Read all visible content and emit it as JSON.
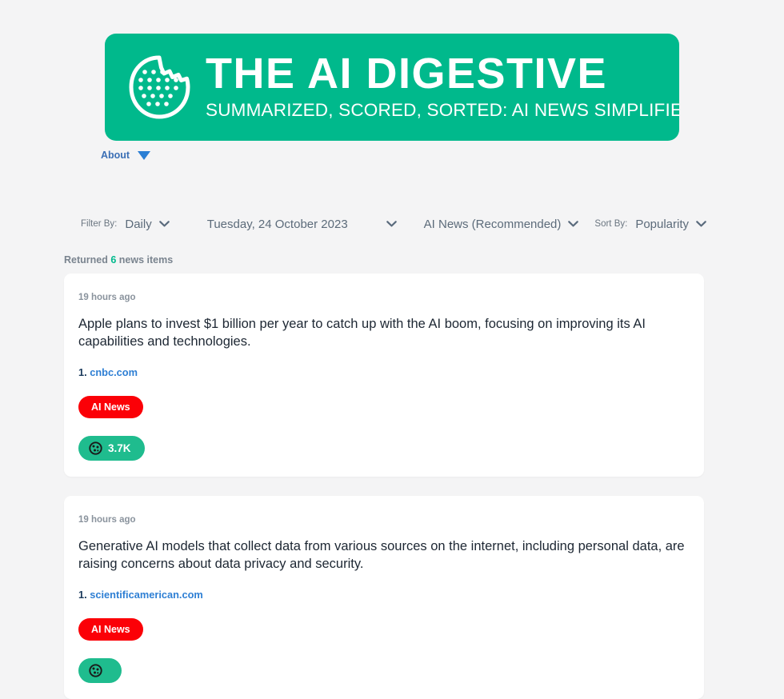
{
  "site": {
    "banner_title": "THE AI DIGESTIVE",
    "banner_subtitle": "SUMMARIZED, SCORED, SORTED: AI NEWS SIMPLIFIED.",
    "banner_color": "#00b98c",
    "logo_icon": "cookie-icon"
  },
  "nav": {
    "about_label": "About",
    "caret_icon": "caret-down-icon"
  },
  "filters": {
    "filter_by_label": "Filter By:",
    "frequency": {
      "value": "Daily",
      "icon": "chevron-down-icon"
    },
    "date": {
      "value": "Tuesday, 24 October 2023",
      "icon": "chevron-down-icon"
    },
    "category": {
      "value": "AI News (Recommended)",
      "icon": "chevron-down-icon"
    },
    "sort_by_label": "Sort By:",
    "sort": {
      "value": "Popularity",
      "icon": "chevron-down-icon"
    }
  },
  "results": {
    "prefix": "Returned",
    "count": "6",
    "suffix": "news items"
  },
  "news_items": [
    {
      "time": "19 hours ago",
      "summary": "Apple plans to invest $1 billion per year to catch up with the AI boom, focusing on improving its AI capabilities and technologies.",
      "source_number": "1.",
      "source_domain": "cnbc.com",
      "tag": "AI News",
      "tag_color": "#fb0007",
      "score": "3.7K",
      "score_icon": "cookie-score-icon",
      "score_color": "#1fbc8e"
    },
    {
      "time": "19 hours ago",
      "summary": "Generative AI models that collect data from various sources on the internet, including personal data, are raising concerns about data privacy and security.",
      "source_number": "1.",
      "source_domain": "scientificamerican.com",
      "tag": "AI News",
      "tag_color": "#fb0007",
      "score": "",
      "score_icon": "cookie-score-icon",
      "score_color": "#1fbc8e"
    }
  ]
}
